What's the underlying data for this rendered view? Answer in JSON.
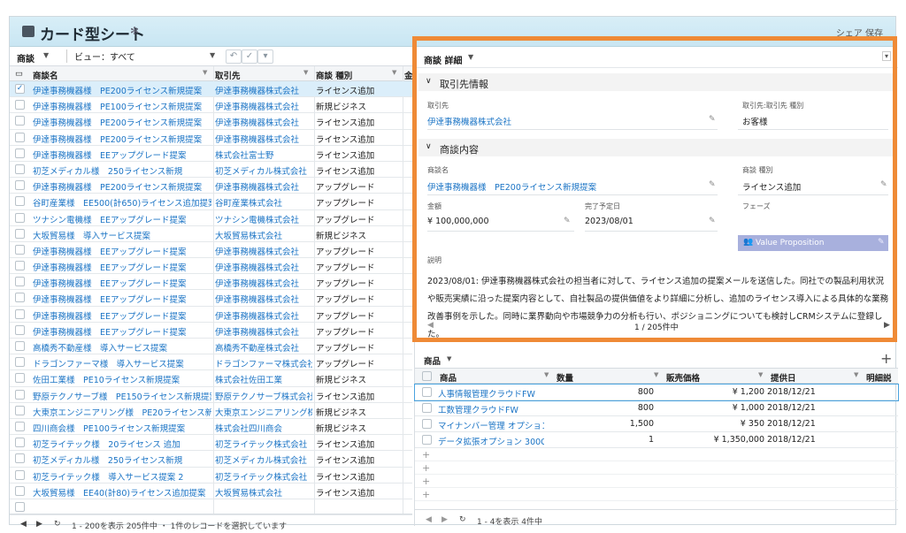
{
  "header": {
    "title": "カード型シート",
    "right_text": "シェア 保存"
  },
  "left": {
    "object_label": "商談",
    "view_label": "ビュー：すべて",
    "columns": [
      "商談名",
      "取引先",
      "商談 種別",
      "金"
    ],
    "rows": [
      {
        "name": "伊達事務機器様　PE200ライセンス新規提案",
        "account": "伊達事務機器株式会社",
        "type": "ライセンス追加",
        "checked": true
      },
      {
        "name": "伊達事務機器様　PE100ライセンス新規提案",
        "account": "伊達事務機器株式会社",
        "type": "新規ビジネス"
      },
      {
        "name": "伊達事務機器様　PE200ライセンス新規提案",
        "account": "伊達事務機器株式会社",
        "type": "ライセンス追加"
      },
      {
        "name": "伊達事務機器様　PE200ライセンス新規提案",
        "account": "伊達事務機器株式会社",
        "type": "ライセンス追加"
      },
      {
        "name": "伊達事務機器様　EEアップグレード提案",
        "account": "株式会社富士野",
        "type": "ライセンス追加"
      },
      {
        "name": "初芝メディカル様　250ライセンス新規",
        "account": "初芝メディカル株式会社",
        "type": "ライセンス追加"
      },
      {
        "name": "伊達事務機器様　PE200ライセンス新規提案",
        "account": "伊達事務機器株式会社",
        "type": "アップグレード"
      },
      {
        "name": "谷町産業様　EE500(計650)ライセンス追加提案",
        "account": "谷町産業株式会社",
        "type": "アップグレード"
      },
      {
        "name": "ツナシン電機様　EEアップグレード提案",
        "account": "ツナシン電機株式会社",
        "type": "アップグレード"
      },
      {
        "name": "大坂貿易様　導入サービス提案",
        "account": "大坂貿易株式会社",
        "type": "新規ビジネス"
      },
      {
        "name": "伊達事務機器様　EEアップグレード提案",
        "account": "伊達事務機器株式会社",
        "type": "アップグレード"
      },
      {
        "name": "伊達事務機器様　EEアップグレード提案",
        "account": "伊達事務機器株式会社",
        "type": "アップグレード"
      },
      {
        "name": "伊達事務機器様　EEアップグレード提案",
        "account": "伊達事務機器株式会社",
        "type": "アップグレード"
      },
      {
        "name": "伊達事務機器様　EEアップグレード提案",
        "account": "伊達事務機器株式会社",
        "type": "アップグレード"
      },
      {
        "name": "伊達事務機器様　EEアップグレード提案",
        "account": "伊達事務機器株式会社",
        "type": "アップグレード"
      },
      {
        "name": "伊達事務機器様　EEアップグレード提案",
        "account": "伊達事務機器株式会社",
        "type": "アップグレード"
      },
      {
        "name": "高橋秀不動産様　導入サービス提案",
        "account": "高橋秀不動産株式会社",
        "type": "アップグレード"
      },
      {
        "name": "ドラゴンファーマ様　導入サービス提案",
        "account": "ドラゴンファーマ株式会社",
        "type": "アップグレード"
      },
      {
        "name": "佐田工業様　PE10ライセンス新規提案",
        "account": "株式会社佐田工業",
        "type": "新規ビジネス"
      },
      {
        "name": "野原テクノサーブ様　PE150ライセンス新規提案",
        "account": "野原テクノサーブ株式会社",
        "type": "ライセンス追加"
      },
      {
        "name": "大東京エンジニアリング様　PE20ライセンス新規...",
        "account": "大東京エンジニアリング株...",
        "type": "新規ビジネス"
      },
      {
        "name": "四川商会様　PE100ライセンス新規提案",
        "account": "株式会社四川商会",
        "type": "新規ビジネス"
      },
      {
        "name": "初芝ライテック様　20ライセンス 追加",
        "account": "初芝ライテック株式会社",
        "type": "ライセンス追加"
      },
      {
        "name": "初芝メディカル様　250ライセンス新規",
        "account": "初芝メディカル株式会社",
        "type": "ライセンス追加"
      },
      {
        "name": "初芝ライテック様　導入サービス提案 2",
        "account": "初芝ライテック株式会社",
        "type": "ライセンス追加"
      },
      {
        "name": "大坂貿易様　EE40(計80)ライセンス追加提案",
        "account": "大坂貿易株式会社",
        "type": "ライセンス追加"
      }
    ],
    "footer": "1 - 200を表示 205件中 ・ 1件のレコードを選択しています"
  },
  "detail": {
    "header_label": "商談 詳細",
    "section1": "取引先情報",
    "account_label": "取引先",
    "account_value": "伊達事務機器株式会社",
    "account_type_label": "取引先:取引先 種別",
    "account_type_value": "お客様",
    "section2": "商談内容",
    "opp_name_label": "商談名",
    "opp_name_value": "伊達事務機器様　PE200ライセンス新規提案",
    "opp_type_label": "商談 種別",
    "opp_type_value": "ライセンス追加",
    "amount_label": "金額",
    "amount_value": "¥ 100,000,000",
    "close_label": "完了予定日",
    "close_value": "2023/08/01",
    "phase_label": "フェーズ",
    "phase_value": "Value Proposition",
    "desc_label": "説明",
    "desc_value": "2023/08/01: 伊達事務機器株式会社の担当者に対して、ライセンス追加の提案メールを送信した。同社での製品利用状況や販売実績に沿った提案内容として、自社製品の提供価値をより詳細に分析し、追加のライセンス導入による具体的な業務改善事例を示した。同時に業界動向や市場競争力の分析も行い、ポジショニングについても検討しCRMシステムに登録した。",
    "pager": "1 / 205件中"
  },
  "products": {
    "label": "商品",
    "columns": [
      "商品",
      "数量",
      "販売価格",
      "提供日",
      "明細説"
    ],
    "rows": [
      {
        "name": "人事情報管理クラウドFW",
        "qty": "800",
        "price": "¥ 1,200",
        "date": "2018/12/21"
      },
      {
        "name": "工数管理クラウドFW",
        "qty": "800",
        "price": "¥ 1,000",
        "date": "2018/12/21"
      },
      {
        "name": "マイナンバー管理 オプション",
        "qty": "1,500",
        "price": "¥ 350",
        "date": "2018/12/21"
      },
      {
        "name": "データ拡張オプション 300G...",
        "qty": "1",
        "price": "¥ 1,350,000",
        "date": "2018/12/21"
      }
    ],
    "footer": "1 - 4を表示 4件中"
  }
}
